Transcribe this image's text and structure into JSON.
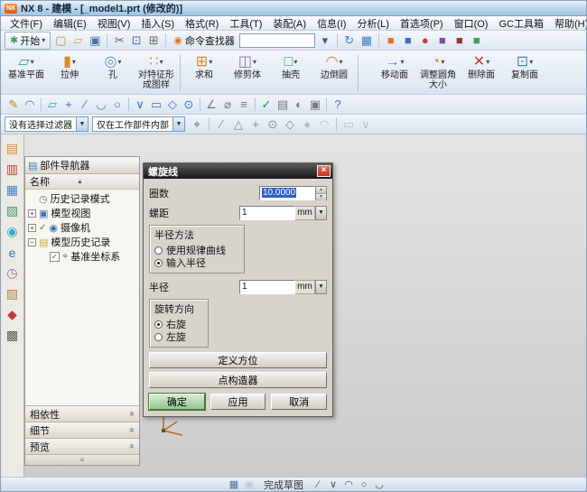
{
  "window": {
    "title": "NX 8 - 建模 - [_model1.prt (修改的)]",
    "logo": "NX"
  },
  "glyphs": {
    "caret_down": "▾",
    "arrow_down": "▼",
    "arrow_up": "▲",
    "close": "×",
    "grip": "≡",
    "chevron_double": "«",
    "sort_asc": "▲"
  },
  "menubar": {
    "items": [
      "文件(F)",
      "编辑(E)",
      "视图(V)",
      "插入(S)",
      "格式(R)",
      "工具(T)",
      "装配(A)",
      "信息(I)",
      "分析(L)",
      "首选项(P)",
      "窗口(O)",
      "GC工具箱",
      "帮助(H)"
    ]
  },
  "toolbar_top": {
    "start_label": "开始",
    "command_finder_label": "命令查找器",
    "command_input_value": "",
    "left_icons": [
      {
        "name": "new-file-icon",
        "glyph": "▢",
        "color": "#b8912f"
      },
      {
        "name": "open-icon",
        "glyph": "▱",
        "color": "#d9a43c"
      },
      {
        "name": "save-icon",
        "glyph": "▣",
        "color": "#4a6fa5"
      },
      {
        "sep": true
      },
      {
        "name": "cut-icon",
        "glyph": "✂",
        "color": "#5a5a5a"
      },
      {
        "name": "copy-icon",
        "glyph": "⊡",
        "color": "#4a6fa5"
      },
      {
        "name": "paste-icon",
        "glyph": "⊞",
        "color": "#6a6a6a"
      },
      {
        "sep": true
      }
    ],
    "right_icons": [
      {
        "name": "search-dropdown-icon",
        "glyph": "▾",
        "color": "#345a7a"
      },
      {
        "sep": true
      },
      {
        "name": "refresh-icon",
        "glyph": "↻",
        "color": "#3f7fbf"
      },
      {
        "name": "window-layout-icon",
        "glyph": "▦",
        "color": "#3f7fbf"
      },
      {
        "sep": true
      },
      {
        "name": "shaded-view-icon",
        "glyph": "■",
        "color": "#d9782a"
      },
      {
        "name": "wireframe-view-icon",
        "glyph": "■",
        "color": "#3f6fb5"
      },
      {
        "name": "render-style-icon",
        "glyph": "●",
        "color": "#c23b3b"
      },
      {
        "name": "orient-view-icon",
        "glyph": "■",
        "color": "#7a4fa3"
      },
      {
        "name": "section-view-icon",
        "glyph": "■",
        "color": "#8a3a3a"
      },
      {
        "name": "snapshot-icon",
        "glyph": "■",
        "color": "#3f9b5f"
      }
    ]
  },
  "feature_toolbar": {
    "buttons": [
      {
        "label": "基准平面",
        "glyph": "▱",
        "color": "#3aa0a0"
      },
      {
        "label": "拉伸",
        "glyph": "▮",
        "color": "#d98a2b"
      },
      {
        "label": "孔",
        "glyph": "◎",
        "color": "#5a8fc0"
      },
      {
        "label": "对特征形成图样",
        "glyph": "∷",
        "color": "#d98a2b"
      },
      {
        "label": "求和",
        "glyph": "⊞",
        "color": "#d98a2b"
      },
      {
        "label": "修剪体",
        "glyph": "◫",
        "color": "#8a6fb8"
      },
      {
        "label": "抽壳",
        "glyph": "□",
        "color": "#4a9b5f"
      },
      {
        "label": "边倒圆",
        "glyph": "◠",
        "color": "#d98a2b"
      },
      {
        "label": "移动面",
        "glyph": "→",
        "color": "#4a84c4"
      },
      {
        "label": "调整圆角大小",
        "glyph": "◔",
        "color": "#d98a2b"
      },
      {
        "label": "删除面",
        "glyph": "✕",
        "color": "#c23b3b"
      },
      {
        "label": "复制面",
        "glyph": "⊡",
        "color": "#4a84c4"
      }
    ]
  },
  "toolbar_small": {
    "icons": [
      {
        "name": "sketch-icon",
        "glyph": "✎",
        "color": "#b8860b"
      },
      {
        "name": "sketch-in-task-icon",
        "glyph": "◠",
        "color": "#3f6fb5"
      },
      {
        "sep": true
      },
      {
        "name": "datum-plane-small-icon",
        "glyph": "▱",
        "color": "#3aa0a0"
      },
      {
        "name": "point-icon",
        "glyph": "+",
        "color": "#3f6fb5"
      },
      {
        "name": "line-icon",
        "glyph": "∕",
        "color": "#3f6fb5"
      },
      {
        "name": "arc-icon",
        "glyph": "◡",
        "color": "#3f6fb5"
      },
      {
        "name": "circle-icon",
        "glyph": "○",
        "color": "#3f6fb5"
      },
      {
        "sep": true
      },
      {
        "name": "profile-icon",
        "glyph": "∨",
        "color": "#3f6fb5"
      },
      {
        "name": "rectangle-icon",
        "glyph": "▭",
        "color": "#3f6fb5"
      },
      {
        "name": "polygon-icon",
        "glyph": "◇",
        "color": "#3f6fb5"
      },
      {
        "name": "ellipse-icon",
        "glyph": "⊙",
        "color": "#3f6fb5"
      },
      {
        "sep": true
      },
      {
        "name": "angle-icon",
        "glyph": "∠",
        "color": "#7a7a7a"
      },
      {
        "name": "diameter-icon",
        "glyph": "⌀",
        "color": "#7a7a7a"
      },
      {
        "name": "offset-icon",
        "glyph": "≡",
        "color": "#7a7a7a"
      },
      {
        "sep": true
      },
      {
        "name": "verify-icon",
        "glyph": "✓",
        "color": "#2f8f2f"
      },
      {
        "name": "layer-icon",
        "glyph": "▤",
        "color": "#7a7a7a"
      },
      {
        "name": "visibility-icon",
        "glyph": "◐",
        "color": "#7a7a7a"
      },
      {
        "name": "lock-icon",
        "glyph": "▣",
        "color": "#7a7a7a"
      },
      {
        "sep": true
      },
      {
        "name": "help-icon",
        "glyph": "?",
        "color": "#3f6fb5"
      }
    ]
  },
  "selection_bar": {
    "filter_value": "没有选择过滤器",
    "scope_value": "仅在工作部件内部",
    "icons": [
      {
        "name": "snap-point-toggle-icon",
        "glyph": "⌖",
        "color": "#6a6a6a"
      },
      {
        "sep": true
      },
      {
        "name": "endpoint-snap-icon",
        "glyph": "∕",
        "color": "#8a8a8a"
      },
      {
        "name": "midpoint-snap-icon",
        "glyph": "△",
        "color": "#8a8a8a"
      },
      {
        "name": "intersection-snap-icon",
        "glyph": "+",
        "color": "#8a8a8a"
      },
      {
        "name": "center-snap-icon",
        "glyph": "⊙",
        "color": "#8a8a8a"
      },
      {
        "name": "quadrant-snap-icon",
        "glyph": "◇",
        "color": "#8a8a8a"
      },
      {
        "name": "existing-point-snap-icon",
        "glyph": "●",
        "color": "#8a8a8a",
        "dim": true
      },
      {
        "name": "tangent-snap-icon",
        "glyph": "◠",
        "color": "#8a8a8a",
        "dim": true
      },
      {
        "sep": true
      },
      {
        "name": "face-rule-icon",
        "glyph": "▭",
        "color": "#8a8a8a",
        "dim": true
      },
      {
        "name": "curve-rule-icon",
        "glyph": "∨",
        "color": "#8a8a8a",
        "dim": true
      }
    ]
  },
  "resource_bar": {
    "icons": [
      {
        "name": "assembly-navigator-icon",
        "glyph": "▤",
        "color": "#d98a2b"
      },
      {
        "name": "constraint-navigator-icon",
        "glyph": "▥",
        "color": "#c23b3b"
      },
      {
        "name": "part-navigator-icon",
        "glyph": "▦",
        "color": "#3f7fbf"
      },
      {
        "name": "reuse-library-icon",
        "glyph": "▧",
        "color": "#3f9b5f"
      },
      {
        "name": "hd3d-tools-icon",
        "glyph": "◉",
        "color": "#2faac8"
      },
      {
        "name": "web-browser-icon",
        "glyph": "e",
        "color": "#2f6fc4"
      },
      {
        "name": "history-icon",
        "glyph": "◷",
        "color": "#8a6fb0"
      },
      {
        "name": "system-materials-icon",
        "glyph": "▨",
        "color": "#b08a3f"
      },
      {
        "name": "process-studio-icon",
        "glyph": "◆",
        "color": "#c23b3b"
      },
      {
        "name": "roles-icon",
        "glyph": "▩",
        "color": "#5a5a5a"
      }
    ]
  },
  "navigator": {
    "title": "部件导航器",
    "header_icon": "▤",
    "header_icon_color": "#3f7fbf",
    "column_header": "名称",
    "rows": [
      {
        "label": "历史记录模式",
        "glyph": "◷",
        "color": "#7a7a7a"
      },
      {
        "label": "模型视图",
        "glyph": "▣",
        "color": "#3f6fb5",
        "expander": "+"
      },
      {
        "label": "摄像机",
        "glyph": "◉",
        "color": "#3f6fb5",
        "expander": "+",
        "check": "✓"
      },
      {
        "label": "模型历史记录",
        "glyph": "▤",
        "color": "#d9a43c",
        "expander": "−"
      },
      {
        "label": "基准坐标系",
        "glyph": "⌖",
        "color": "#3f9b5f",
        "checkbox": "✓"
      }
    ],
    "panels": [
      "相依性",
      "细节",
      "预览"
    ]
  },
  "dialog": {
    "title": "螺旋线",
    "turns": {
      "label": "圈数",
      "value": "10.0000"
    },
    "pitch": {
      "label": "螺距",
      "value": "1",
      "unit": "mm"
    },
    "radius_method": {
      "title": "半径方法",
      "options": [
        "使用规律曲线",
        "输入半径"
      ]
    },
    "radius": {
      "label": "半径",
      "value": "1",
      "unit": "mm"
    },
    "rotation": {
      "title": "旋转方向",
      "options": [
        "右旋",
        "左旋"
      ]
    },
    "define_orientation_label": "定义方位",
    "point_constructor_label": "点构造器",
    "ok_label": "确定",
    "apply_label": "应用",
    "cancel_label": "取消"
  },
  "statusbar": {
    "finish_label": "完成草图",
    "icons_left": [
      {
        "name": "sketch-tools-icon",
        "glyph": "▦",
        "color": "#4a6fa5"
      },
      {
        "name": "update-display-icon",
        "glyph": "▣",
        "color": "#9aa4ae",
        "dim": true
      }
    ],
    "icons_right": [
      {
        "name": "profile-line-icon",
        "glyph": "∕",
        "color": "#4a4a4a"
      },
      {
        "name": "polyline-icon",
        "glyph": "∨",
        "color": "#4a4a4a"
      },
      {
        "name": "arc-icon",
        "glyph": "◠",
        "color": "#4a4a4a"
      },
      {
        "name": "circle-icon",
        "glyph": "○",
        "color": "#4a4a4a"
      },
      {
        "name": "fillet-icon",
        "glyph": "◡",
        "color": "#4a4a4a"
      }
    ]
  }
}
